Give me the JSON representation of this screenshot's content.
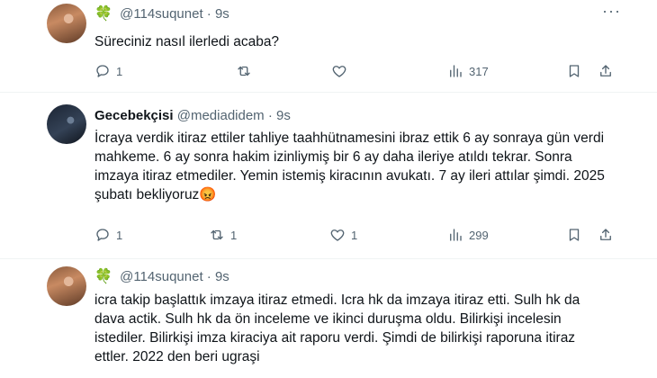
{
  "tweets": [
    {
      "badge": "🍀",
      "name": "",
      "handle": "@114suqunet",
      "dot": "·",
      "time": "9s",
      "text": "Süreciniz nasıl ilerledi acaba?",
      "replies": "1",
      "retweets": "",
      "likes": "",
      "views": "317"
    },
    {
      "badge": "",
      "name": "Gecebekçisi",
      "handle": "@mediadidem",
      "dot": "·",
      "time": "9s",
      "text": "İcraya verdik itiraz ettiler tahliye taahhütnamesini ibraz ettik 6 ay sonraya gün verdi mahkeme. 6 ay sonra hakim izinliymiş bir 6 ay daha ileriye atıldı tekrar. Sonra imzaya itiraz etmediler. Yemin istemiş kiracının avukatı. 7 ay ileri attılar şimdi. 2025 şubatı bekliyoruz😡",
      "replies": "1",
      "retweets": "1",
      "likes": "1",
      "views": "299"
    },
    {
      "badge": "🍀",
      "name": "",
      "handle": "@114suqunet",
      "dot": "·",
      "time": "9s",
      "text": "icra takip başlattık imzaya itiraz etmedi. Icra hk da imzaya itiraz etti. Sulh hk da dava actik. Sulh hk da ön inceleme ve ikinci duruşma oldu. Bilirkişi incelesin istediler. Bilirkişi imza kiraciya ait raporu verdi. Şimdi de bilirkişi raporuna itiraz ettler. 2022 den beri ugraşi"
    }
  ]
}
